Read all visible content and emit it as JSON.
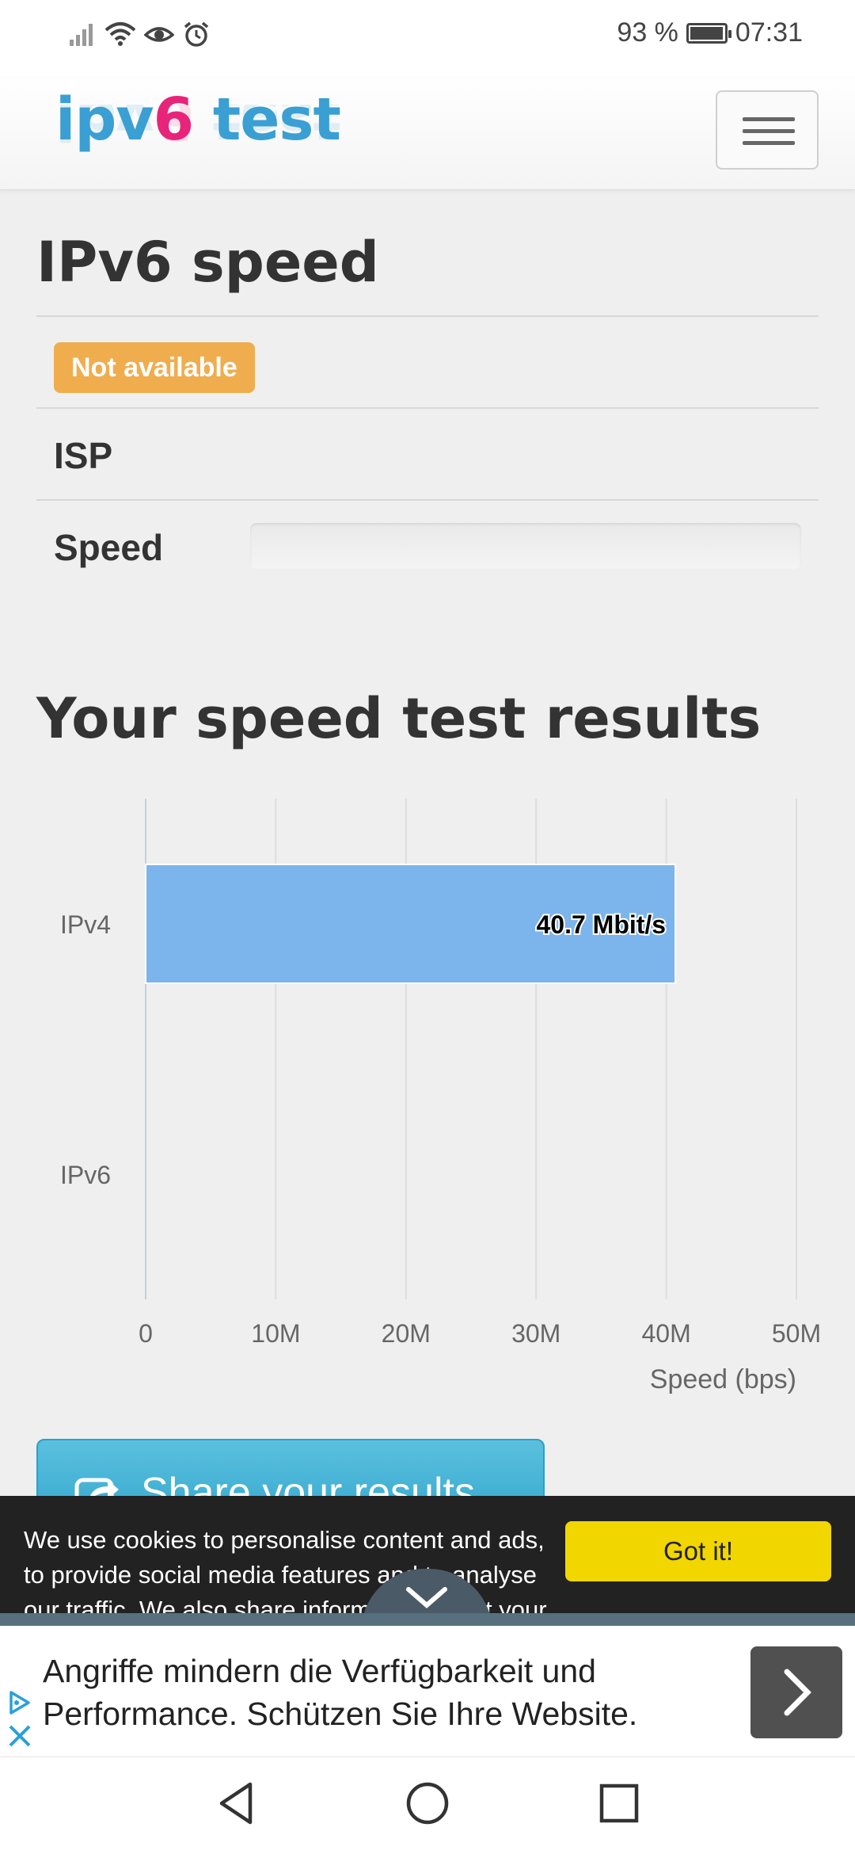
{
  "status_bar": {
    "battery_text": "93 %",
    "battery_level": 0.93,
    "time": "07:31",
    "icons": [
      "signal-icon",
      "wifi-icon",
      "eye-comfort-icon",
      "alarm-icon",
      "battery-icon"
    ]
  },
  "navbar": {
    "logo_part1": "ipv",
    "logo_part2": "6",
    "logo_part3": " test",
    "menu_icon": "hamburger-icon"
  },
  "ipv6_speed": {
    "title": "IPv6 speed",
    "badge": "Not available",
    "isp_label": "ISP",
    "speed_label": "Speed"
  },
  "results": {
    "title": "Your speed test results"
  },
  "chart_data": {
    "type": "bar",
    "orientation": "horizontal",
    "categories": [
      "IPv4",
      "IPv6"
    ],
    "values": [
      40700000,
      null
    ],
    "data_labels": [
      "40.7 Mbit/s",
      ""
    ],
    "xlabel": "Speed (bps)",
    "ylabel": "",
    "xlim": [
      0,
      50000000
    ],
    "xticks": [
      0,
      10000000,
      20000000,
      30000000,
      40000000,
      50000000
    ],
    "xtick_labels": [
      "0",
      "10M",
      "20M",
      "30M",
      "40M",
      "50M"
    ],
    "bar_color": "#7cb5ec",
    "grid": true
  },
  "share": {
    "label": "Share your results",
    "icon": "share-icon"
  },
  "cookie": {
    "text": "We use cookies to personalise content and ads, to provide social media features and to analyse our traffic. We also share information about your use of our",
    "button": "Got it!",
    "collapse_icon": "chevron-down-icon"
  },
  "ad": {
    "text_line1": "Angriffe mindern die Verfügbarkeit und",
    "text_line2": "Performance. Schützen Sie Ihre Website.",
    "arrow_icon": "chevron-right-icon",
    "adchoices_icon": "adchoices-icon",
    "close_icon": "close-icon"
  },
  "system_nav": {
    "back_icon": "back-icon",
    "home_icon": "home-icon",
    "recents_icon": "recents-icon"
  }
}
